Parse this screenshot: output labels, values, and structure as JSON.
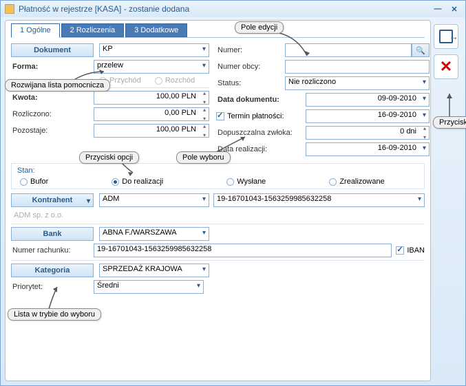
{
  "window": {
    "title": "Płatność w rejestrze [KASA] - zostanie dodana"
  },
  "tabs": {
    "t1": "1 Ogólne",
    "t2": "2 Rozliczenia",
    "t3": "3 Dodatkowe"
  },
  "headers": {
    "dokument": "Dokument",
    "kontrahent": "Kontrahent",
    "bank": "Bank",
    "kategoria": "Kategoria"
  },
  "labels": {
    "forma": "Forma:",
    "przychod": "Przychód",
    "rozchod": "Rozchód",
    "kwota": "Kwota:",
    "rozliczono": "Rozliczono:",
    "pozostaje": "Pozostaje:",
    "stan": "Stan:",
    "numer": "Numer:",
    "numer_obcy": "Numer obcy:",
    "status": "Status:",
    "data_dokumentu": "Data dokumentu:",
    "termin_platnosci": "Termin płatności:",
    "dopuszczalna_zwloka": "Dopuszczalna zwłoka:",
    "data_realizacji": "Data realizacji:",
    "bufor": "Bufor",
    "do_realizacji": "Do realizacji",
    "wyslane": "Wysłane",
    "zrealizowane": "Zrealizowane",
    "numer_rachunku": "Numer rachunku:",
    "iban": "IBAN",
    "priorytet": "Priorytet:"
  },
  "values": {
    "dokument_type": "KP",
    "forma": "przelew",
    "kwota": "100,00 PLN",
    "rozliczono": "0,00 PLN",
    "pozostaje": "100,00 PLN",
    "status": "Nie rozliczono",
    "data_dokumentu": "09-09-2010",
    "termin_platnosci": "16-09-2010",
    "dopuszczalna_zwloka": "0 dni",
    "data_realizacji": "16-09-2010",
    "kontrahent": "ADM",
    "kontrahent_full": "ADM sp. z o.o.",
    "rachunek_select": "19-16701043-1563259985632258",
    "bank": "ABNA F./WARSZAWA",
    "numer_rachunku": "19-16701043-1563259985632258",
    "kategoria": "SPRZEDAŻ KRAJOWA",
    "priorytet": "Średni"
  },
  "callouts": {
    "pole_edycji": "Pole edycji",
    "rozwijana": "Rozwijana lista pomocnicza",
    "przyciski_opcji": "Przyciski opcji",
    "pole_wyboru": "Pole wyboru",
    "przyciski": "Przyciski",
    "lista_trybie": "Lista w trybie do wyboru"
  }
}
